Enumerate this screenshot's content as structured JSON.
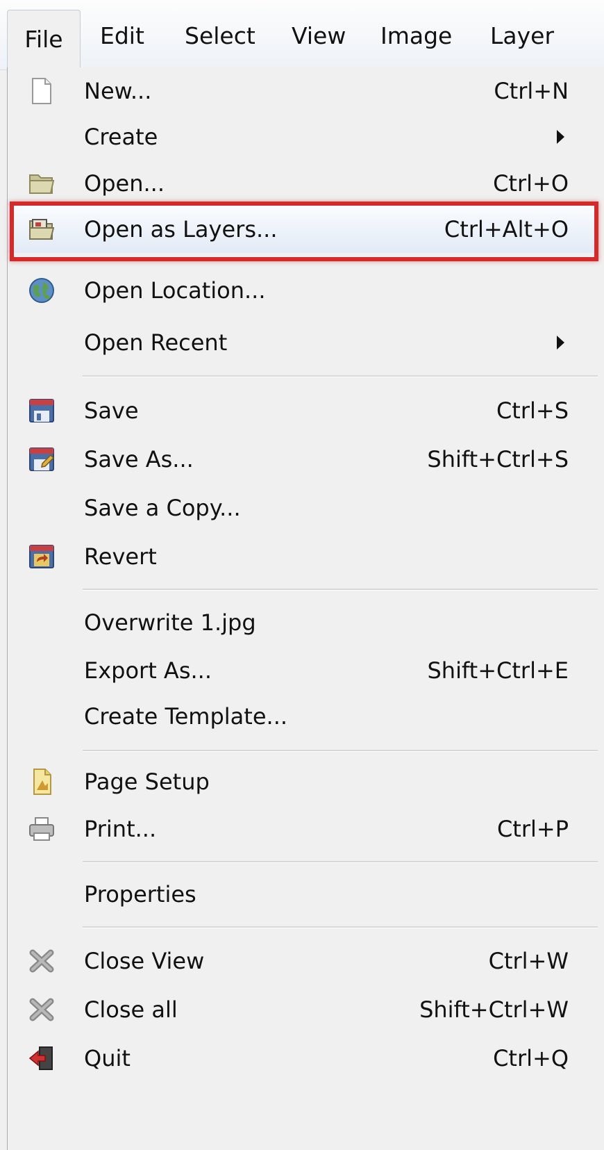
{
  "menubar": {
    "items": [
      "File",
      "Edit",
      "Select",
      "View",
      "Image",
      "Layer"
    ]
  },
  "menu": {
    "new": {
      "label": "New...",
      "shortcut": "Ctrl+N",
      "icon": "new-document-icon"
    },
    "create": {
      "label": "Create"
    },
    "open": {
      "label": "Open...",
      "shortcut": "Ctrl+O",
      "icon": "folder-open-icon"
    },
    "open_as_layers": {
      "label": "Open as Layers...",
      "shortcut": "Ctrl+Alt+O",
      "icon": "open-as-layers-icon"
    },
    "open_location": {
      "label": "Open Location...",
      "icon": "globe-icon"
    },
    "open_recent": {
      "label": "Open Recent"
    },
    "save": {
      "label": "Save",
      "shortcut": "Ctrl+S",
      "icon": "save-icon"
    },
    "save_as": {
      "label": "Save As...",
      "shortcut": "Shift+Ctrl+S",
      "icon": "save-as-icon"
    },
    "save_copy": {
      "label": "Save a Copy..."
    },
    "revert": {
      "label": "Revert",
      "icon": "revert-icon"
    },
    "overwrite": {
      "label": "Overwrite 1.jpg"
    },
    "export_as": {
      "label": "Export As...",
      "shortcut": "Shift+Ctrl+E"
    },
    "create_template": {
      "label": "Create Template..."
    },
    "page_setup": {
      "label": "Page Setup",
      "icon": "page-setup-icon"
    },
    "print": {
      "label": "Print...",
      "shortcut": "Ctrl+P",
      "icon": "printer-icon"
    },
    "properties": {
      "label": "Properties"
    },
    "close_view": {
      "label": "Close View",
      "shortcut": "Ctrl+W",
      "icon": "close-icon"
    },
    "close_all": {
      "label": "Close all",
      "shortcut": "Shift+Ctrl+W",
      "icon": "close-icon"
    },
    "quit": {
      "label": "Quit",
      "shortcut": "Ctrl+Q",
      "icon": "quit-icon"
    }
  },
  "colors": {
    "highlight_border": "#d42a2a",
    "menu_background": "#f0f0f0"
  }
}
